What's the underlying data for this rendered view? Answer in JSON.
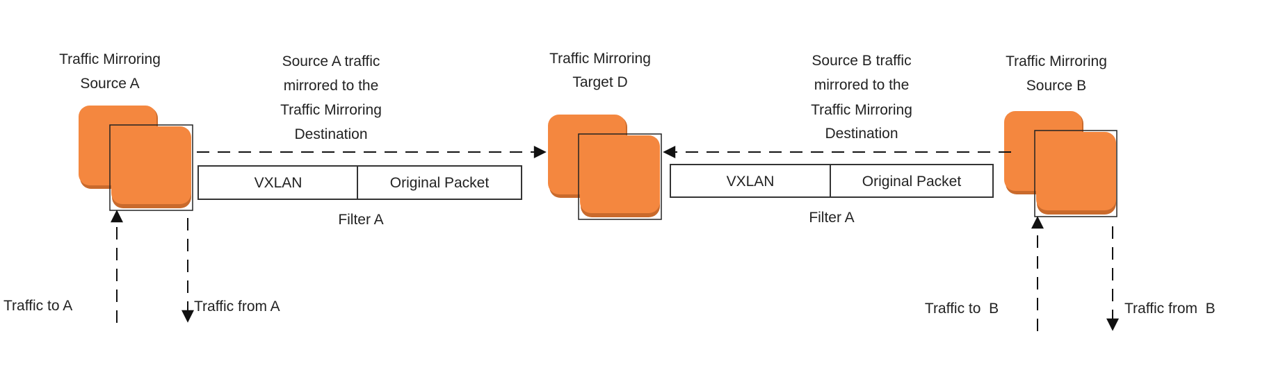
{
  "colors": {
    "instance": "#F4873F",
    "instance_shadow": "#C96A2C",
    "line": "#111111"
  },
  "nodes": {
    "source_a": {
      "line1": "Traffic Mirroring",
      "line2": "Source A",
      "icon": "instance-icon"
    },
    "target_d": {
      "line1": "Traffic Mirroring",
      "line2": "Target D",
      "icon": "instance-icon"
    },
    "source_b": {
      "line1": "Traffic Mirroring",
      "line2": "Source B",
      "icon": "instance-icon"
    }
  },
  "flows": {
    "a_to_d": {
      "caption": [
        "Source A traffic",
        "mirrored to the",
        "Traffic Mirroring",
        "Destination"
      ],
      "packet": [
        "VXLAN",
        "Original Packet"
      ],
      "filter": "Filter A"
    },
    "b_to_d": {
      "caption": [
        "Source B traffic",
        "mirrored to the",
        "Traffic Mirroring",
        "Destination"
      ],
      "packet": [
        "VXLAN",
        "Original Packet"
      ],
      "filter": "Filter A"
    }
  },
  "traffic": {
    "to_a": "Traffic to A",
    "from_a": "Traffic from A",
    "to_b": "Traffic to  B",
    "from_b": "Traffic from  B"
  }
}
